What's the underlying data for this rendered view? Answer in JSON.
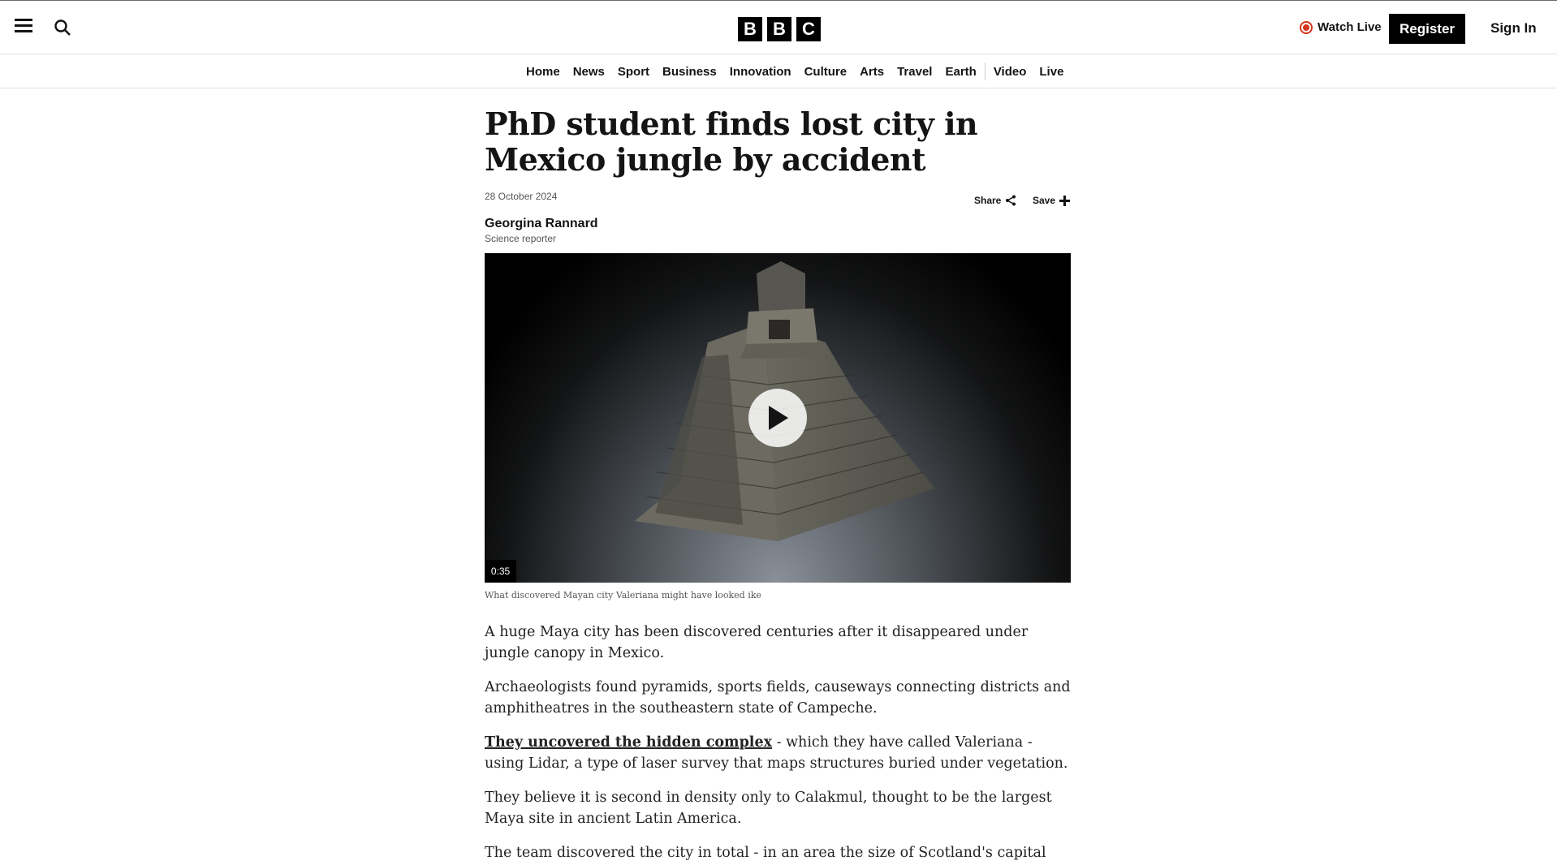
{
  "header": {
    "logo_letters": [
      "B",
      "B",
      "C"
    ],
    "watch_live": "Watch Live",
    "register": "Register",
    "sign_in": "Sign In"
  },
  "nav": {
    "items": [
      "Home",
      "News",
      "Sport",
      "Business",
      "Innovation",
      "Culture",
      "Arts",
      "Travel",
      "Earth",
      "Video",
      "Live"
    ]
  },
  "article": {
    "headline": "PhD student finds lost city in Mexico jungle by accident",
    "date": "28 October 2024",
    "share_label": "Share",
    "save_label": "Save",
    "author": "Georgina Rannard",
    "author_role": "Science reporter",
    "video": {
      "duration": "0:35",
      "caption": "What discovered Mayan city Valeriana might have looked ike"
    },
    "paragraphs": [
      {
        "text": "A huge Maya city has been discovered centuries after it disappeared under jungle canopy in Mexico."
      },
      {
        "text": "Archaeologists found pyramids, sports fields, causeways connecting districts and amphitheatres in the southeastern state of Campeche."
      },
      {
        "link": "They uncovered the hidden complex",
        "text": " - which they have called Valeriana - using Lidar, a type of laser survey that maps structures buried under vegetation."
      },
      {
        "text": "They believe it is second in density only to Calakmul, thought to be the largest Maya site in ancient Latin America."
      },
      {
        "text": "The team discovered the city in total - in an area the size of Scotland's capital"
      }
    ]
  },
  "colors": {
    "live_red": "#d4351c",
    "black": "#000000"
  }
}
